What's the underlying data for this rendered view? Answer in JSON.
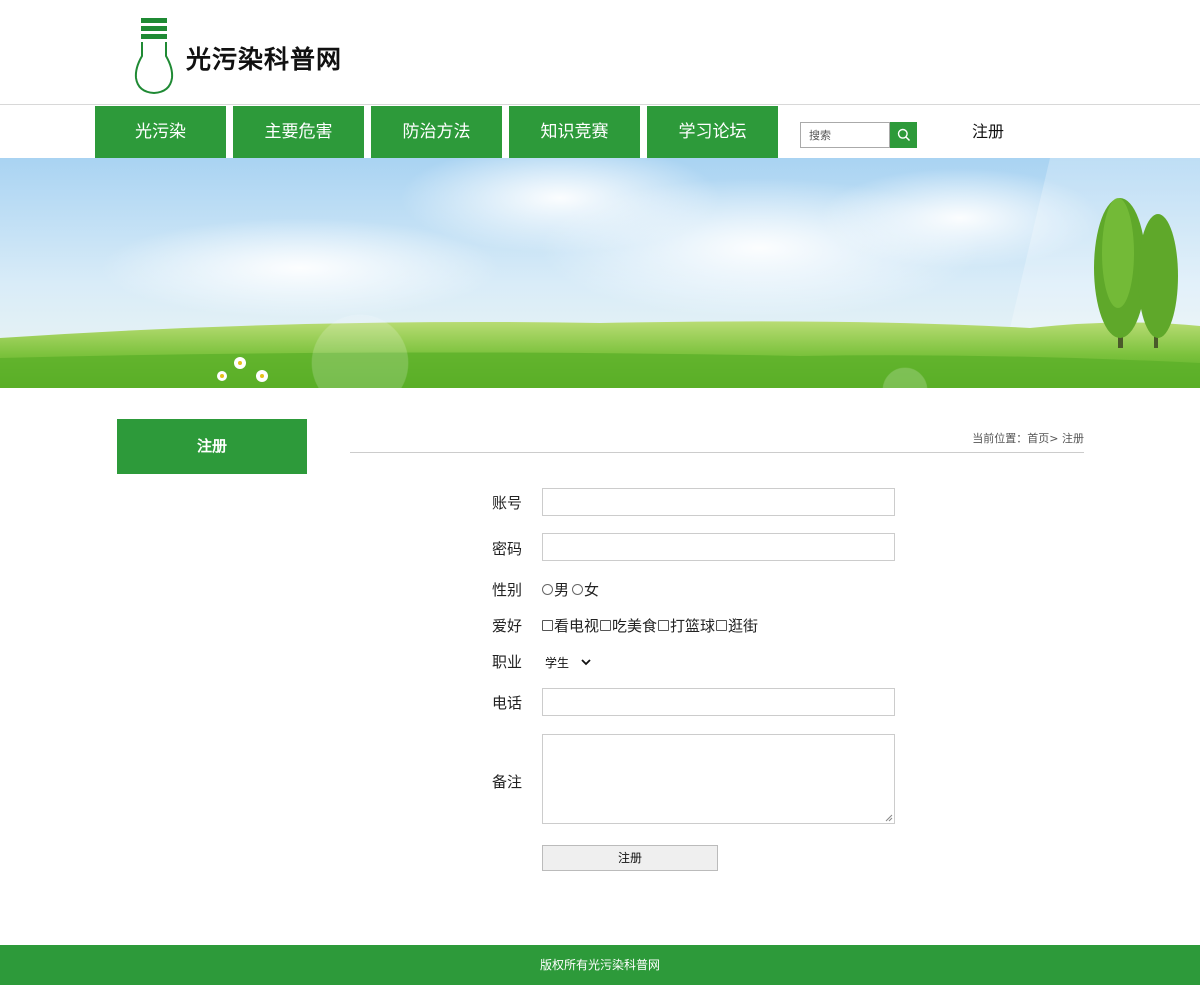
{
  "header": {
    "site_name": "光污染科普网",
    "logo_icon": "lightbulb-logo-icon"
  },
  "nav": {
    "items": [
      {
        "label": "光污染"
      },
      {
        "label": "主要危害"
      },
      {
        "label": "防治方法"
      },
      {
        "label": "知识竞赛"
      },
      {
        "label": "学习论坛"
      }
    ],
    "search_placeholder": "搜索",
    "search_icon": "search-icon",
    "register_label": "注册"
  },
  "sidebar": {
    "title": "注册"
  },
  "breadcrumb": {
    "prefix": "当前位置：",
    "home": "首页",
    "separator": ">",
    "current": " 注册"
  },
  "form": {
    "account_label": "账号",
    "password_label": "密码",
    "gender_label": "性别",
    "gender_options": [
      "男",
      "女"
    ],
    "hobby_label": "爱好",
    "hobby_options": [
      "看电视",
      "吃美食",
      "打篮球",
      "逛街"
    ],
    "job_label": "职业",
    "job_selected": "学生",
    "phone_label": "电话",
    "note_label": "备注",
    "submit_label": "注册"
  },
  "footer": {
    "copyright": "版权所有光污染科普网"
  },
  "colors": {
    "brand_green": "#2d9a3a"
  }
}
